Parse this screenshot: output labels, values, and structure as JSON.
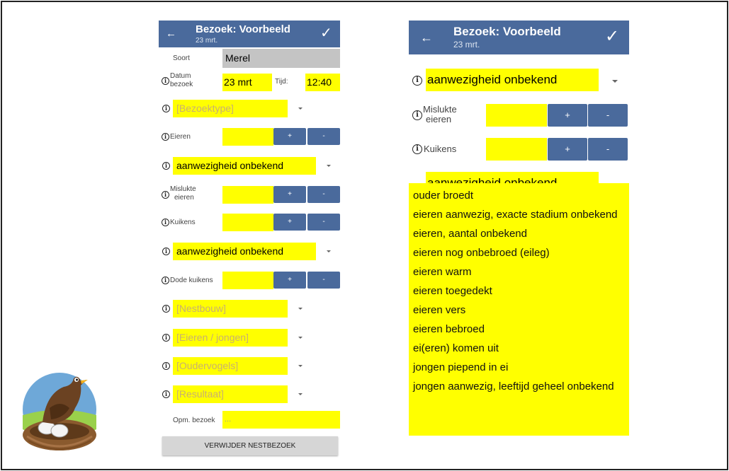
{
  "left": {
    "header": {
      "title": "Bezoek: Voorbeeld",
      "subtitle": "23 mrt."
    },
    "soort": {
      "label": "Soort",
      "value": "Merel"
    },
    "datum": {
      "label_line1": "Datum",
      "label_line2": "bezoek",
      "value": "23 mrt",
      "tijd_label": "Tijd:",
      "tijd_value": "12:40"
    },
    "bezoektype": {
      "placeholder": "[Bezoektype]"
    },
    "eieren": {
      "label": "Eieren"
    },
    "aanwezigheid1": {
      "value": "aanwezigheid onbekend"
    },
    "mislukte": {
      "label_line1": "Mislukte",
      "label_line2": "eieren"
    },
    "kuikens": {
      "label": "Kuikens"
    },
    "aanwezigheid2": {
      "value": "aanwezigheid onbekend"
    },
    "dode": {
      "label": "Dode kuikens"
    },
    "nestbouw": {
      "placeholder": "[Nestbouw]"
    },
    "eieren_jongen": {
      "placeholder": "[Eieren / jongen]"
    },
    "oudervogels": {
      "placeholder": "[Oudervogels]"
    },
    "resultaat": {
      "placeholder": "[Resultaat]"
    },
    "opm": {
      "label": "Opm. bezoek",
      "placeholder": "..."
    },
    "delete_button": "VERWIJDER NESTBEZOEK",
    "plus": "+",
    "minus": "-"
  },
  "right": {
    "header": {
      "title": "Bezoek: Voorbeeld",
      "subtitle": "23 mrt."
    },
    "aanwezigheid": {
      "value": "aanwezigheid onbekend"
    },
    "mislukte": {
      "label_line1": "Mislukte",
      "label_line2": "eieren"
    },
    "kuikens": {
      "label": "Kuikens"
    },
    "aanwezigheid_partial": {
      "value": "aanwezigheid onbekend"
    },
    "plus": "+",
    "minus": "-",
    "dropdown_options": [
      "ouder broedt",
      "eieren aanwezig, exacte stadium onbekend",
      "eieren, aantal onbekend",
      "eieren nog onbebroed (eileg)",
      "eieren warm",
      "eieren toegedekt",
      "eieren vers",
      "eieren bebroed",
      "ei(eren) komen uit",
      "jongen piepend in ei",
      "jongen aanwezig, leeftijd geheel onbekend"
    ]
  },
  "icons": {
    "back": "arrow-left-icon",
    "confirm": "checkmark-icon",
    "info": "info-icon",
    "dropdown": "caret-down-icon"
  },
  "colors": {
    "header": "#4a6a9c",
    "highlight": "#ffff00",
    "button": "#4a6a9c"
  }
}
